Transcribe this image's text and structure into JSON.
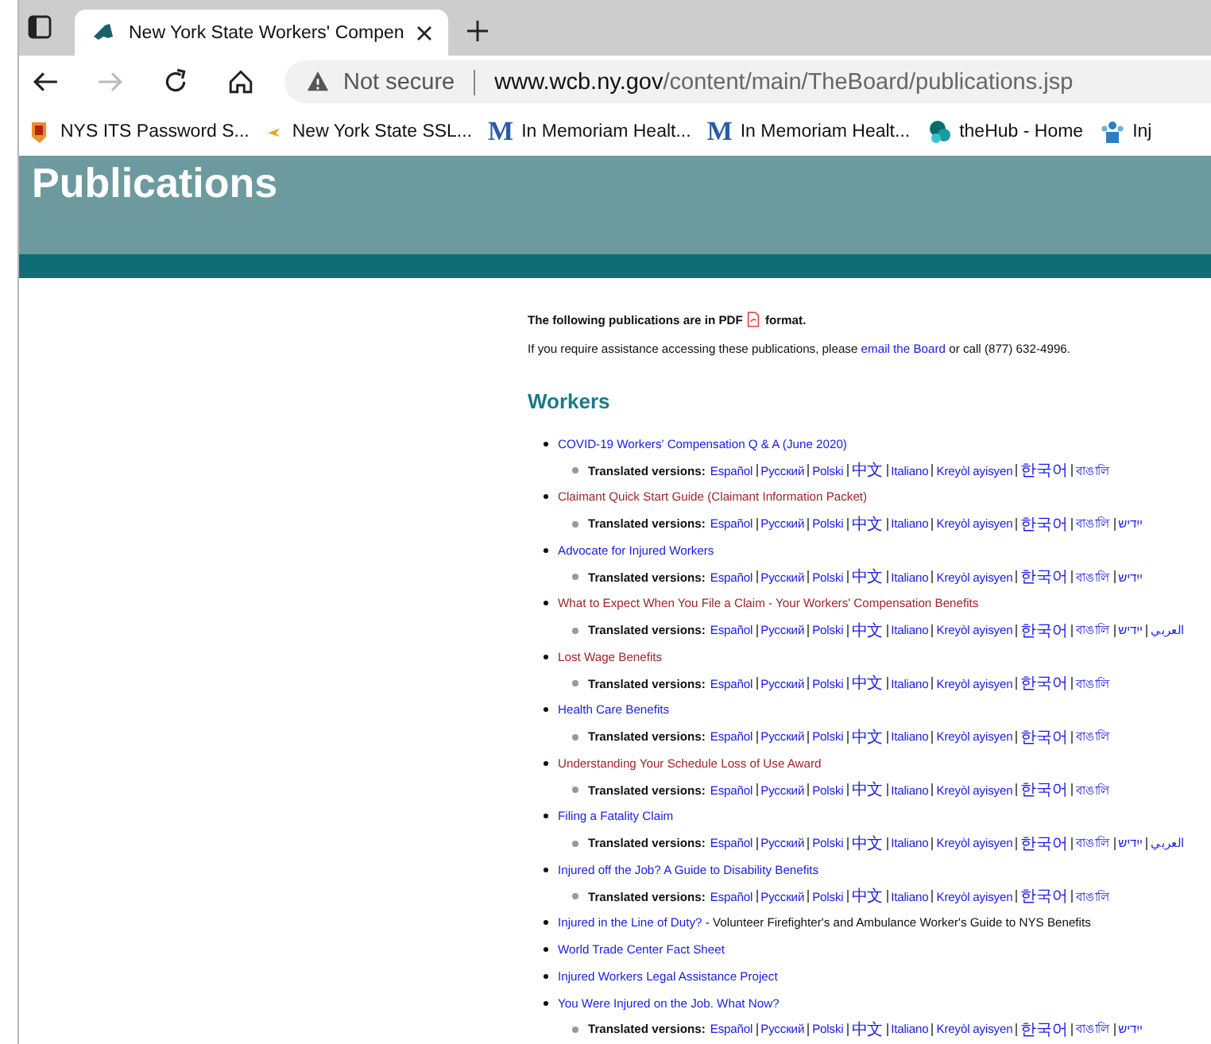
{
  "browser": {
    "tab_title": "New York State Workers' Compen",
    "security": "Not secure",
    "url_domain": "www.wcb.ny.gov",
    "url_path": "/content/main/TheBoard/publications.jsp",
    "bookmarks": [
      {
        "kind": "shield",
        "label": "NYS ITS Password S..."
      },
      {
        "kind": "arrow",
        "label": "New York State SSL..."
      },
      {
        "kind": "letter",
        "icon_text": "M",
        "label": "In Memoriam Healt..."
      },
      {
        "kind": "letter",
        "icon_text": "M",
        "label": "In Memoriam Healt..."
      },
      {
        "kind": "sharepoint",
        "label": "theHub - Home"
      },
      {
        "kind": "people",
        "label": "Inj"
      }
    ]
  },
  "page": {
    "title": "Publications",
    "pdf_note_before": "The following publications are in PDF",
    "pdf_note_after": "format.",
    "assist_before": "If you require assistance accessing these publications, please",
    "assist_link": "email the Board",
    "assist_after": "or call (877) 632-4996.",
    "section": "Workers",
    "items": [
      {
        "title": "COVID-19 Workers' Compensation Q & A (June 2020)",
        "visited": false,
        "translated_label": "Translated versions:",
        "translations": [
          "Español",
          "Русский",
          "Polski",
          "中文",
          "Italiano",
          "Kreyòl ayisyen",
          "한국어",
          "বাঙালি"
        ]
      },
      {
        "title": "Claimant Quick Start Guide (Claimant Information Packet)",
        "visited": true,
        "translated_label": "Translated versions:",
        "translations": [
          "Español",
          "Русский",
          "Polski",
          "中文",
          "Italiano",
          "Kreyòl ayisyen",
          "한국어",
          "বাঙালি",
          "ייִדיש"
        ]
      },
      {
        "title": "Advocate for Injured Workers",
        "visited": false,
        "translated_label": "Translated versions:",
        "translations": [
          "Español",
          "Русский",
          "Polski",
          "中文",
          "Italiano",
          "Kreyòl ayisyen",
          "한국어",
          "বাঙালি",
          "ייִדיש"
        ]
      },
      {
        "title": "What to Expect When You File a Claim - Your Workers' Compensation Benefits",
        "visited": true,
        "translated_label": "Translated versions:",
        "translations": [
          "Español",
          "Русский",
          "Polski",
          "中文",
          "Italiano",
          "Kreyòl ayisyen",
          "한국어",
          "বাঙালি",
          "ייִדיש",
          "العربي"
        ]
      },
      {
        "title": "Lost Wage Benefits",
        "visited": true,
        "translated_label": "Translated versions:",
        "translations": [
          "Español",
          "Русский",
          "Polski",
          "中文",
          "Italiano",
          "Kreyòl ayisyen",
          "한국어",
          "বাঙালি"
        ]
      },
      {
        "title": "Health Care Benefits",
        "visited": false,
        "translated_label": "Translated versions:",
        "translations": [
          "Español",
          "Русский",
          "Polski",
          "中文",
          "Italiano",
          "Kreyòl ayisyen",
          "한국어",
          "বাঙালি"
        ]
      },
      {
        "title": "Understanding Your Schedule Loss of Use Award",
        "visited": true,
        "translated_label": "Translated versions:",
        "translations": [
          "Español",
          "Русский",
          "Polski",
          "中文",
          "Italiano",
          "Kreyòl ayisyen",
          "한국어",
          "বাঙালি"
        ]
      },
      {
        "title": "Filing a Fatality Claim",
        "visited": false,
        "translated_label": "Translated versions:",
        "translations": [
          "Español",
          "Русский",
          "Polski",
          "中文",
          "Italiano",
          "Kreyòl ayisyen",
          "한국어",
          "বাঙালি",
          "ייִדיש",
          "العربي"
        ]
      },
      {
        "title": "Injured off the Job? A Guide to Disability Benefits",
        "visited": false,
        "translated_label": "Translated versions:",
        "translations": [
          "Español",
          "Русский",
          "Polski",
          "中文",
          "Italiano",
          "Kreyòl ayisyen",
          "한국어",
          "বাঙালি"
        ]
      },
      {
        "title": "Injured in the Line of Duty?",
        "visited": false,
        "note": "- Volunteer Firefighter's and Ambulance Worker's Guide to NYS Benefits"
      },
      {
        "title": "World Trade Center Fact Sheet",
        "visited": false
      },
      {
        "title": "Injured Workers Legal Assistance Project",
        "visited": false
      },
      {
        "title": "You Were Injured on the Job. What Now?",
        "visited": false,
        "translated_label": "Translated versions:",
        "translations": [
          "Español",
          "Русский",
          "Polski",
          "中文",
          "Italiano",
          "Kreyòl ayisyen",
          "한국어",
          "বাঙালি",
          "ייִדיש"
        ]
      }
    ]
  }
}
